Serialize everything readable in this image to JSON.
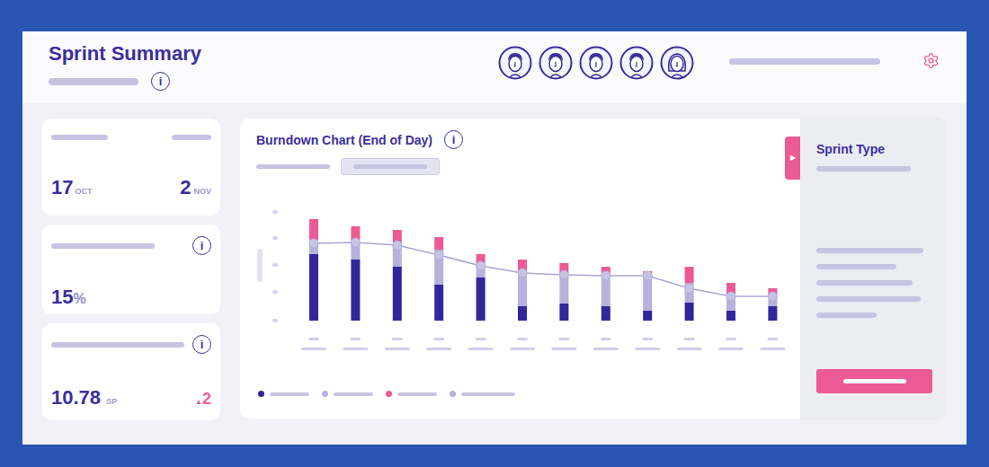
{
  "header": {
    "title": "Sprint Summary",
    "info": "i",
    "avatars": [
      {
        "kind": "man"
      },
      {
        "kind": "man"
      },
      {
        "kind": "man"
      },
      {
        "kind": "man"
      },
      {
        "kind": "woman"
      }
    ]
  },
  "dates_card": {
    "start": {
      "day": "17",
      "month": "OCT"
    },
    "end": {
      "day": "2",
      "month": "NOV"
    }
  },
  "percent_card": {
    "info": "i",
    "value": "15",
    "unit": "%"
  },
  "velocity_card": {
    "info": "i",
    "value": "10.78",
    "unit": "SP",
    "change": {
      "arrow": "▲",
      "value": "2"
    }
  },
  "chart": {
    "title": "Burndown Chart (End of Day)",
    "info": "i",
    "tabs": [
      {
        "selected": false
      },
      {
        "selected": true
      }
    ],
    "series": [
      {
        "kind": "bar",
        "color": "#33269a",
        "values": [
          74,
          68,
          60,
          40,
          48,
          16,
          19,
          16,
          11,
          20,
          11,
          16
        ]
      },
      {
        "kind": "bar",
        "color": "#b6b2da",
        "values": [
          16,
          22,
          27,
          39,
          16,
          38,
          33,
          34,
          37,
          22,
          19,
          12
        ]
      },
      {
        "kind": "bar",
        "color": "#ec5b95",
        "values": [
          23,
          15,
          14,
          14,
          10,
          14,
          12,
          10,
          7,
          18,
          12,
          8
        ]
      },
      {
        "kind": "line",
        "color": "#c6c3e6",
        "values": [
          86,
          87,
          84,
          73,
          61,
          53,
          51,
          50,
          50,
          36,
          27,
          27
        ]
      }
    ]
  },
  "side_panel": {
    "title": "Sprint Type",
    "toggle": "▶"
  }
}
